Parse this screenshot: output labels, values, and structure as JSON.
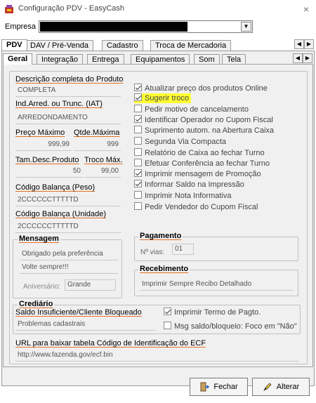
{
  "window": {
    "title": "Configuração PDV - EasyCash",
    "close_glyph": "×"
  },
  "empresa": {
    "label": "Empresa",
    "value": ""
  },
  "outer_tabs": [
    "PDV",
    "DAV / Pré-Venda",
    "Cadastro",
    "Troca de Mercadoria"
  ],
  "inner_tabs": [
    "Geral",
    "Integração",
    "Entrega",
    "Equipamentos",
    "Som",
    "Tela"
  ],
  "left": {
    "descricao_label": "Descrição completa do Produto",
    "descricao_value": "COMPLETA",
    "arred_label": "Ind.Arred. ou Trunc. (IAT)",
    "arred_value": "ARREDONDAMENTO",
    "preco_max_label": "Preço Máximo",
    "preco_max_value": "999,99",
    "qtde_max_label": "Qtde.Máxima",
    "qtde_max_value": "999",
    "tam_desc_label": "Tam.Desc.Produto",
    "tam_desc_value": "50",
    "troco_max_label": "Troco Máx.",
    "troco_max_value": "99,00",
    "cod_peso_label": "Código Balança (Peso)",
    "cod_peso_value": "2CCCCCCTTTTTD",
    "cod_unid_label": "Código Balança (Unidade)",
    "cod_unid_value": "2CCCCCCTTTTTD"
  },
  "checkboxes": [
    {
      "label": "Atualizar preço dos produtos Online",
      "checked": true
    },
    {
      "label": "Sugerir troco",
      "checked": true,
      "highlight": true
    },
    {
      "label": "Pedir motivo de cancelamento",
      "checked": false
    },
    {
      "label": "Identificar Operador no Cupom Fiscal",
      "checked": true
    },
    {
      "label": "Suprimento autom. na Abertura Caixa",
      "checked": false
    },
    {
      "label": "Segunda Via Compacta",
      "checked": false
    },
    {
      "label": "Relatório de Caixa ao fechar Turno",
      "checked": false
    },
    {
      "label": "Efetuar Conferência ao fechar Turno",
      "checked": false
    },
    {
      "label": "Imprimir mensagem de Promoção",
      "checked": true
    },
    {
      "label": "Informar Saldo na Impressão",
      "checked": true
    },
    {
      "label": "Imprimir Nota Informativa",
      "checked": false
    },
    {
      "label": "Pedir Vendedor do Cupom Fiscal",
      "checked": false
    }
  ],
  "mensagem": {
    "title": "Mensagem",
    "line1": "Obrigado pela preferência",
    "line2": "Volte sempre!!!",
    "aniversario_label": "Aniversário:",
    "aniversario_value": "Grande"
  },
  "pagamento": {
    "title": "Pagamento",
    "vias_label": "Nº vias:",
    "vias_value": "01"
  },
  "recebimento": {
    "title": "Recebimento",
    "value": "Imprimir Sempre Recibo Detalhado"
  },
  "crediario": {
    "title": "Crediário",
    "saldo_label": "Saldo Insuficiente/Cliente Bloqueado",
    "saldo_value": "Problemas cadastrais",
    "imprimir_termo": "Imprimir Termo de Pagto.",
    "imprimir_termo_checked": true,
    "msg_saldo": "Msg saldo/bloqueio: Foco em \"Não\"",
    "msg_saldo_checked": false
  },
  "url": {
    "label": "URL para baixar tabela Código de Identificação do ECF",
    "value": "http://www.fazenda.gov/ecf.bin"
  },
  "buttons": {
    "fechar": "Fechar",
    "alterar": "Alterar"
  }
}
